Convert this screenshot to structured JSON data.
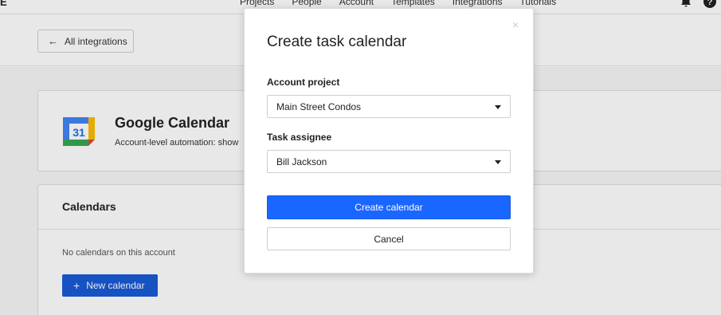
{
  "topbar": {
    "brand_fragment": "E",
    "nav": [
      "Projects",
      "People",
      "Account",
      "Templates",
      "Integrations",
      "Tutorials"
    ],
    "icons": [
      "bell-icon",
      "help-icon"
    ]
  },
  "header": {
    "back_label": "All integrations"
  },
  "integration": {
    "title": "Google Calendar",
    "description": "Account-level automation: show",
    "logo_number": "31"
  },
  "calendars": {
    "title": "Calendars",
    "empty_text": "No calendars on this account",
    "new_button": "New calendar"
  },
  "modal": {
    "close_glyph": "×",
    "title": "Create task calendar",
    "project_label": "Account project",
    "project_value": "Main Street Condos",
    "assignee_label": "Task assignee",
    "assignee_value": "Bill Jackson",
    "create_button": "Create calendar",
    "cancel_button": "Cancel"
  },
  "colors": {
    "primary": "#1a67ff",
    "primary_dark": "#1a5bd6",
    "overlay": "rgba(0,0,0,0.09)"
  }
}
